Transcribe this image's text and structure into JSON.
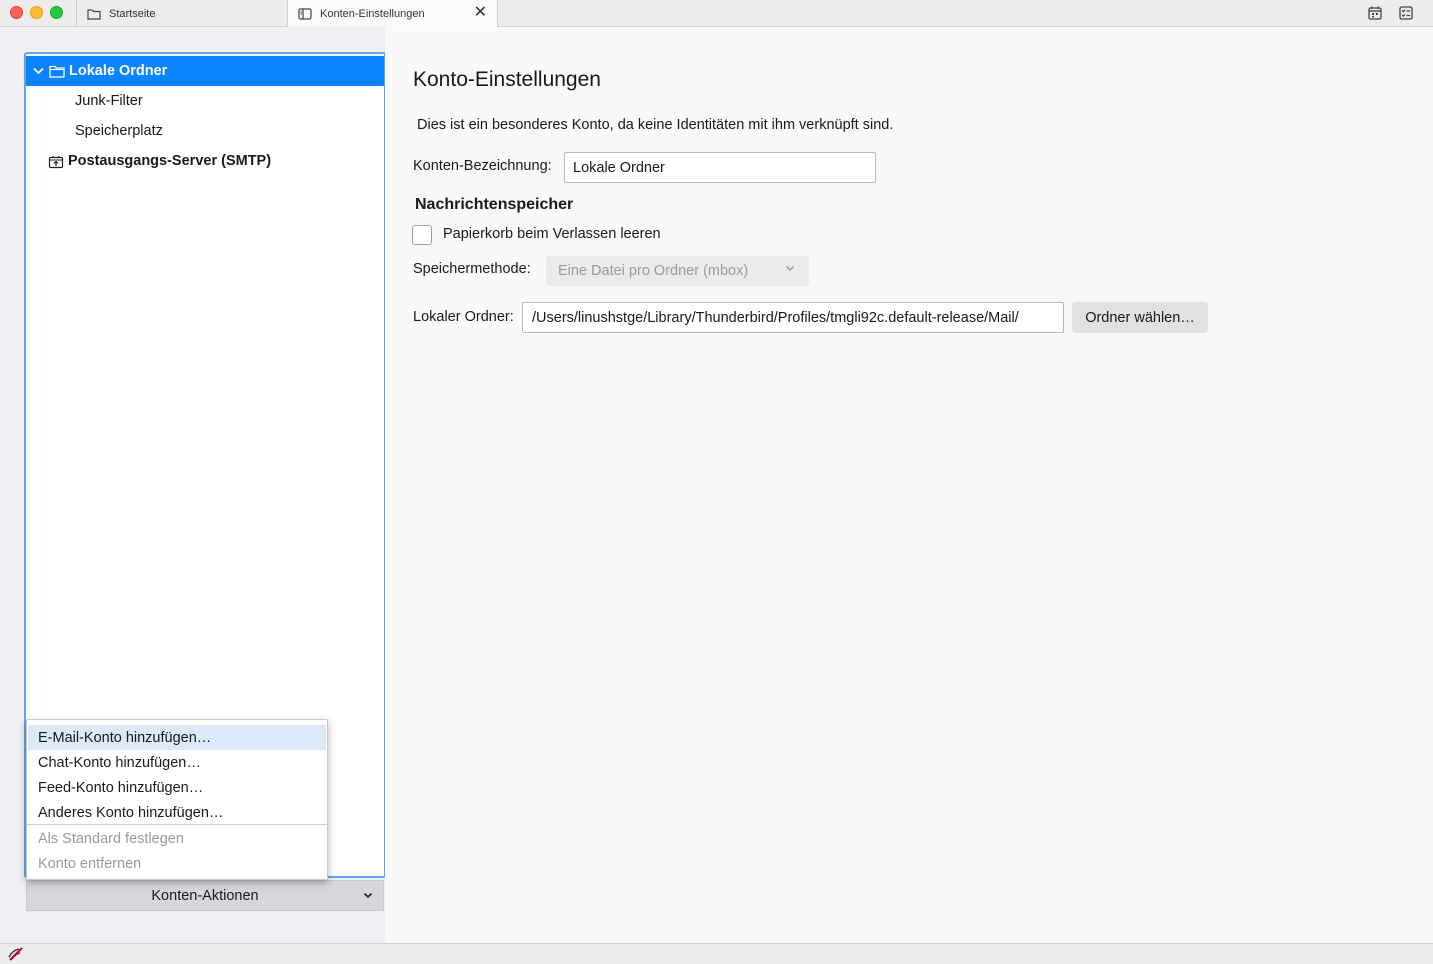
{
  "tabs": [
    {
      "label": "Startseite",
      "icon": "folder-icon"
    },
    {
      "label": "Konten-Einstellungen",
      "icon": "settings-page-icon",
      "active": true
    }
  ],
  "tab_close_glyph": "✕",
  "sidebar": {
    "tree": {
      "account": "Lokale Ordner",
      "children": [
        "Junk-Filter",
        "Speicherplatz"
      ],
      "smtp": "Postausgangs-Server (SMTP)"
    },
    "actions_label": "Konten-Aktionen"
  },
  "menu": {
    "items": [
      {
        "label": "E-Mail-Konto hinzufügen…",
        "enabled": true,
        "highlighted": true
      },
      {
        "label": "Chat-Konto hinzufügen…",
        "enabled": true
      },
      {
        "label": "Feed-Konto hinzufügen…",
        "enabled": true
      },
      {
        "label": "Anderes Konto hinzufügen…",
        "enabled": true
      },
      {
        "label": "Als Standard festlegen",
        "enabled": false
      },
      {
        "label": "Konto entfernen",
        "enabled": false
      }
    ]
  },
  "main": {
    "title": "Konto-Einstellungen",
    "note": "Dies ist ein besonderes Konto, da keine Identitäten mit ihm verknüpft sind.",
    "account_name_label": "Konten-Bezeichnung:",
    "account_name_value": "Lokale Ordner",
    "section_title": "Nachrichtenspeicher",
    "empty_trash_label": "Papierkorb beim Verlassen leeren",
    "empty_trash_checked": false,
    "storage_label": "Speichermethode:",
    "storage_value": "Eine Datei pro Ordner (mbox)",
    "local_dir_label": "Lokaler Ordner:",
    "local_dir_value": "/Users/linushstge/Library/Thunderbird/Profiles/tmgli92c.default-release/Mail/",
    "choose_folder_button": "Ordner wählen…"
  },
  "colors": {
    "selection": "#0a84ff",
    "focus_ring": "#5ea7ee",
    "menu_highlight": "#dbe9f9"
  }
}
